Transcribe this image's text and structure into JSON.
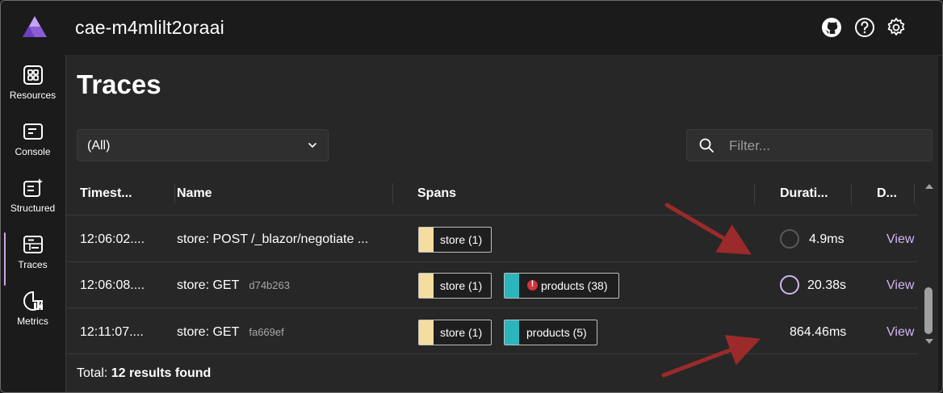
{
  "header": {
    "title": "cae-m4mlilt2oraai",
    "icons": [
      "github-icon",
      "help-icon",
      "settings-icon"
    ]
  },
  "sidebar": {
    "items": [
      {
        "label": "Resources",
        "icon": "resources-icon"
      },
      {
        "label": "Console",
        "icon": "console-icon"
      },
      {
        "label": "Structured",
        "icon": "structured-icon"
      },
      {
        "label": "Traces",
        "icon": "traces-icon",
        "active": true
      },
      {
        "label": "Metrics",
        "icon": "metrics-icon"
      }
    ]
  },
  "page": {
    "title": "Traces"
  },
  "filters": {
    "resource_selected": "(All)",
    "filter_placeholder": "Filter..."
  },
  "table": {
    "columns": [
      "Timest...",
      "Name",
      "Spans",
      "Durati...",
      "D..."
    ],
    "rows": [
      {
        "timestamp": "12:06:02....",
        "name": "store: POST /_blazor/negotiate ...",
        "hash": "",
        "spans": [
          {
            "label": "store (1)",
            "color": "#f5dda0",
            "error": false
          }
        ],
        "duration": "4.9ms",
        "ring": "gray",
        "action": "View"
      },
      {
        "timestamp": "12:06:08....",
        "name": "store: GET",
        "hash": "d74b263",
        "spans": [
          {
            "label": "store (1)",
            "color": "#f5dda0",
            "error": false
          },
          {
            "label": "products (38)",
            "color": "#2bb5bc",
            "error": true
          }
        ],
        "duration": "20.38s",
        "ring": "purple",
        "action": "View"
      },
      {
        "timestamp": "12:11:07....",
        "name": "store: GET",
        "hash": "fa669ef",
        "spans": [
          {
            "label": "store (1)",
            "color": "#f5dda0",
            "error": false
          },
          {
            "label": "products (5)",
            "color": "#2bb5bc",
            "error": false
          }
        ],
        "duration": "864.46ms",
        "ring": "none",
        "action": "View"
      }
    ]
  },
  "footer": {
    "prefix": "Total:",
    "count": "12 results found"
  },
  "colors": {
    "accent": "#d2b5f2",
    "store_span": "#f5dda0",
    "products_span": "#2bb5bc",
    "error": "#d13438",
    "annotation_arrow": "#9b2a2a"
  }
}
